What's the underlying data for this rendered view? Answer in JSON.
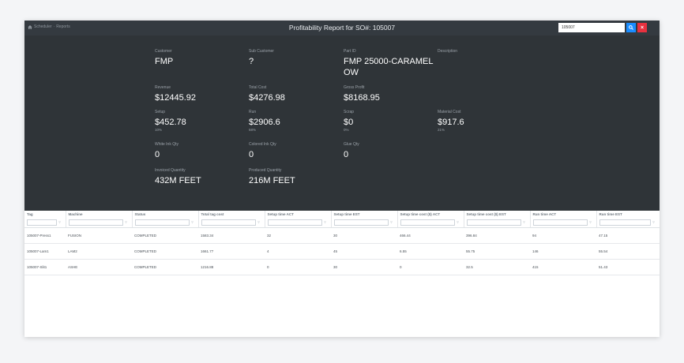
{
  "header": {
    "breadcrumb": [
      "Scheduler",
      "Reports"
    ],
    "title": "Profitability Report for SO#: 105007",
    "search_value": "105007",
    "search_icon": "magnifier-icon",
    "close_label": "×"
  },
  "summary": {
    "customer": {
      "label": "Customer",
      "value": "FMP"
    },
    "sub_customer": {
      "label": "Sub Customer",
      "value": "?"
    },
    "part_id": {
      "label": "Part ID",
      "value": "FMP 25000-CARAMEL OW"
    },
    "description": {
      "label": "Description",
      "value": ""
    },
    "revenue": {
      "label": "Revenue",
      "value": "$12445.92"
    },
    "total_cost": {
      "label": "Total Cost",
      "value": "$4276.98"
    },
    "gross_profit": {
      "label": "Gross Profit",
      "value": "$8168.95"
    },
    "setup": {
      "label": "Setup",
      "value": "$452.78",
      "pct": "10%"
    },
    "run": {
      "label": "Run",
      "value": "$2906.6",
      "pct": "68%"
    },
    "scrap": {
      "label": "Scrap",
      "value": "$0",
      "pct": "0%"
    },
    "material_cost": {
      "label": "Material Cost",
      "value": "$917.6",
      "pct": "21%"
    },
    "white_ink_qty": {
      "label": "White Ink Qty",
      "value": "0"
    },
    "colored_ink_qty": {
      "label": "Colored Ink Qty",
      "value": "0"
    },
    "glue_qty": {
      "label": "Glue Qty",
      "value": "0"
    },
    "invoiced_quantity": {
      "label": "Invoiced Quantity",
      "value": "432M FEET"
    },
    "produced_quantity": {
      "label": "Produced Quantity",
      "value": "216M FEET"
    }
  },
  "table": {
    "columns": [
      "Tag",
      "Machine",
      "Status",
      "Total tag cost",
      "Setup time ACT",
      "Setup time EST",
      "Setup time cost ($) ACT",
      "Setup time cost ($) EST",
      "Run time ACT",
      "Run time EST"
    ],
    "rows": [
      [
        "105007-Press1",
        "FUSION",
        "COMPLETED",
        "1583.34",
        "32",
        "30",
        "466.44",
        "396.84",
        "94",
        "47.15"
      ],
      [
        "105007-Lam1",
        "LAM2",
        "COMPLETED",
        "1661.77",
        "4",
        "45",
        "6.55",
        "55.75",
        "146",
        "55.54"
      ],
      [
        "105007-Slit1",
        "ASHE",
        "COMPLETED",
        "1216.88",
        "0",
        "30",
        "0",
        "32.5",
        "415",
        "51.43"
      ]
    ]
  }
}
